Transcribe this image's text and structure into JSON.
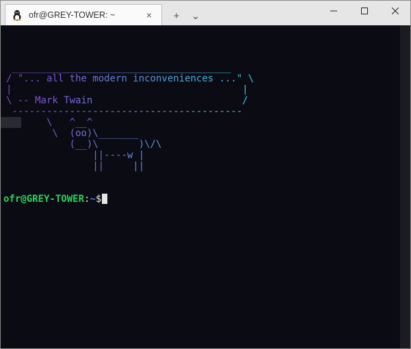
{
  "tab": {
    "title": "ofr@GREY-TOWER: ~",
    "icon_name": "tux-icon"
  },
  "tab_controls": {
    "close_glyph": "×",
    "new_tab_glyph": "+",
    "dropdown_glyph": "⌄"
  },
  "window_controls": {
    "minimize": "minimize-button",
    "maximize": "maximize-button",
    "close": "close-button"
  },
  "colors": {
    "terminal_bg": "#0b0b14",
    "prompt_user": "#27d35a",
    "prompt_path": "#4a7fe0",
    "gradient_start": "#8a3fd1",
    "gradient_end": "#34d0de"
  },
  "art": {
    "lines": [
      " ______________________________________",
      "/ \"... all the modern inconveniences ...\" \\",
      "|                                        |",
      "\\ -- Mark Twain                          /",
      " ----------------------------------------",
      "       \\   ^__^",
      "        \\  (oo)\\_______",
      "           (__)\\       )\\/\\",
      "               ||----w |",
      "               ||     ||"
    ]
  },
  "prompt": {
    "user_host": "ofr@GREY-TOWER",
    "separator": ":",
    "path": "~",
    "symbol": "$"
  }
}
